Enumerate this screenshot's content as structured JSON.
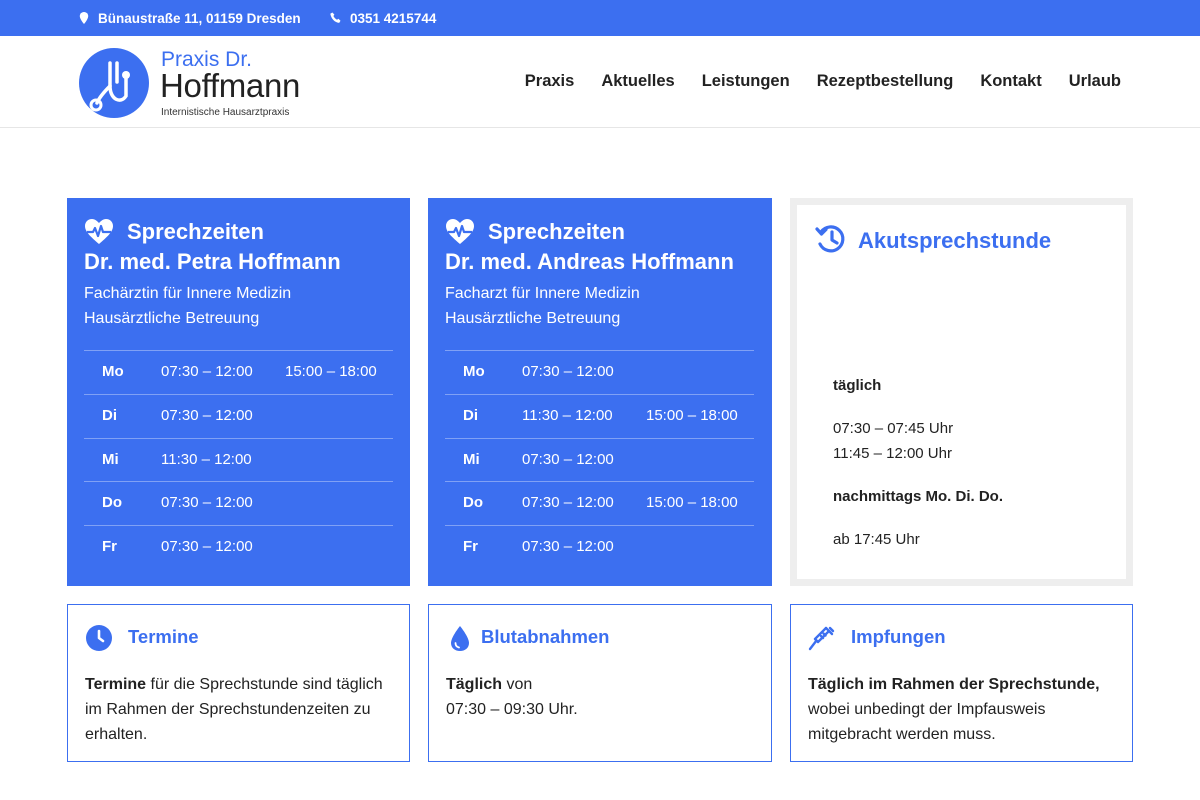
{
  "topbar": {
    "address": "Bünaustraße 11, 01159 Dresden",
    "phone": "0351 4215744"
  },
  "logo": {
    "line1": "Praxis Dr.",
    "line2": "Hoffmann",
    "line3": "Internistische Hausarztpraxis"
  },
  "nav": [
    "Praxis",
    "Aktuelles",
    "Leistungen",
    "Rezeptbestellung",
    "Kontakt",
    "Urlaub"
  ],
  "card1": {
    "title1": "Sprechzeiten",
    "title2": "Dr. med. Petra Hoffmann",
    "sub1": "Fachärztin für Innere Medizin",
    "sub2": "Hausärztliche Betreuung",
    "rows": [
      {
        "day": "Mo",
        "t1": "07:30 – 12:00",
        "t2": "15:00 – 18:00"
      },
      {
        "day": "Di",
        "t1": "07:30 – 12:00",
        "t2": ""
      },
      {
        "day": "Mi",
        "t1": "11:30 – 12:00",
        "t2": ""
      },
      {
        "day": "Do",
        "t1": "07:30 – 12:00",
        "t2": ""
      },
      {
        "day": "Fr",
        "t1": "07:30 – 12:00",
        "t2": ""
      }
    ]
  },
  "card2": {
    "title1": "Sprechzeiten",
    "title2": "Dr. med. Andreas Hoffmann",
    "sub1": "Facharzt für Innere Medizin",
    "sub2": "Hausärztliche Betreuung",
    "rows": [
      {
        "day": "Mo",
        "t1": "07:30 – 12:00",
        "t2": ""
      },
      {
        "day": "Di",
        "t1": "11:30 – 12:00",
        "t2": "15:00 – 18:00"
      },
      {
        "day": "Mi",
        "t1": "07:30 – 12:00",
        "t2": ""
      },
      {
        "day": "Do",
        "t1": "07:30 – 12:00",
        "t2": "15:00 – 18:00"
      },
      {
        "day": "Fr",
        "t1": "07:30 – 12:00",
        "t2": ""
      }
    ]
  },
  "akut": {
    "title": "Akutsprechstunde",
    "label_daily": "täglich",
    "time1": "07:30 – 07:45 Uhr",
    "time2": "11:45 – 12:00 Uhr",
    "label_afternoon": "nachmittags  Mo. Di. Do.",
    "time3": "ab 17:45 Uhr"
  },
  "termine": {
    "title": "Termine",
    "bold": "Termine",
    "text": " für die Sprechstunde sind täglich im Rahmen der Sprechstundenzeiten zu erhalten."
  },
  "blut": {
    "title": "Blutabnahmen",
    "bold": "Täglich",
    "text": " von",
    "text2": "07:30 – 09:30 Uhr."
  },
  "impf": {
    "title": "Impfungen",
    "bold": "Täglich im Rahmen der Sprechstunde,",
    "text": " wobei unbedingt der Impfausweis mitgebracht werden muss."
  },
  "colors": {
    "accent": "#3c6ff0",
    "panel_border": "#eeeeee"
  }
}
